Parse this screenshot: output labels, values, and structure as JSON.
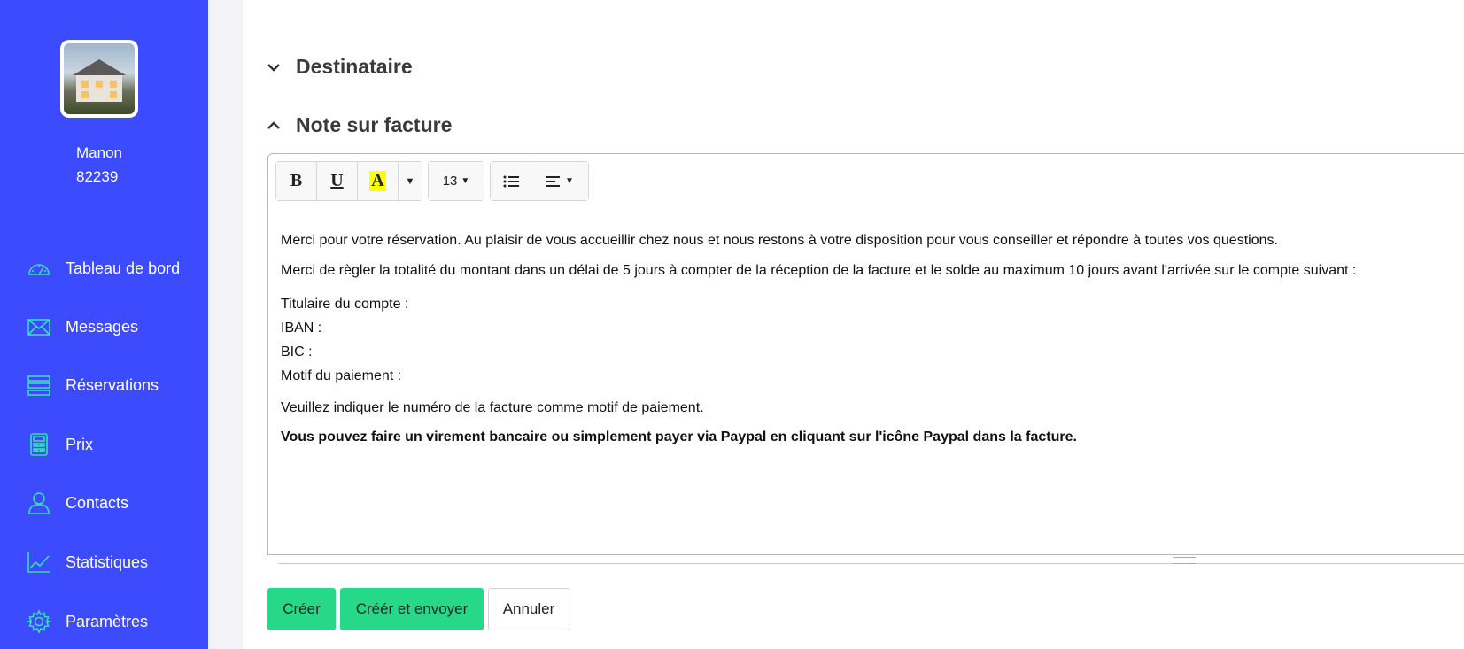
{
  "sidebar": {
    "user_name": "Manon",
    "user_id": "82239",
    "items": [
      {
        "label": "Tableau de bord",
        "icon": "dashboard-gauge-icon"
      },
      {
        "label": "Messages",
        "icon": "envelope-icon"
      },
      {
        "label": "Réservations",
        "icon": "list-icon"
      },
      {
        "label": "Prix",
        "icon": "calculator-icon"
      },
      {
        "label": "Contacts",
        "icon": "user-icon"
      },
      {
        "label": "Statistiques",
        "icon": "line-chart-icon"
      },
      {
        "label": "Paramètres",
        "icon": "gear-icon"
      }
    ]
  },
  "sections": {
    "recipient_title": "Destinataire",
    "note_title": "Note sur facture"
  },
  "toolbar": {
    "bold": "B",
    "underline": "U",
    "highlight": "A",
    "font_size": "13"
  },
  "editor": {
    "p1": [
      "Merci pour votre réservation. Au plaisir de vous accueillir chez nous et nous restons à votre disposition pour vous conseiller et répondre à toutes vos questions."
    ],
    "p2": "Merci de règler la totalité du montant dans un délai de 5 jours à compter de la réception de la facture et le solde au maximum 10 jours avant l'arrivée sur le compte suivant :",
    "account_holder": "Titulaire du compte :",
    "iban": "IBAN :",
    "bic": "BIC :",
    "payment_reason": "Motif du paiement :",
    "p4": "Veuillez indiquer le numéro de la facture comme motif de paiement.",
    "p5": "Vous pouvez faire un virement bancaire ou simplement payer via Paypal en cliquant sur l'icône Paypal dans la facture."
  },
  "actions": {
    "create": "Créer",
    "create_send": "Créér et envoyer",
    "cancel": "Annuler"
  },
  "colors": {
    "sidebar_bg": "#3d4bff",
    "icon_accent": "#35e0b8",
    "button_green": "#27d888"
  }
}
